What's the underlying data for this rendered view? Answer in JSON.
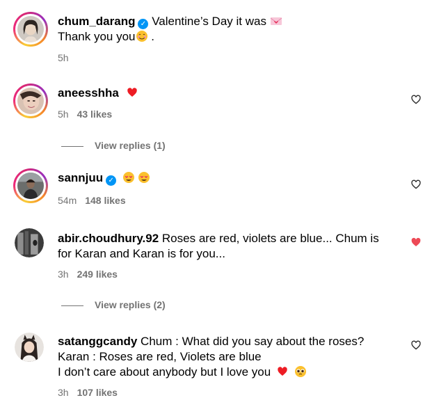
{
  "caption": {
    "username": "chum_darang",
    "line1": "Valentine’s Day it was",
    "line2": "Thank you you",
    "line2_suffix": " .",
    "time": "5h"
  },
  "comments": [
    {
      "username": "aneesshha",
      "time": "5h",
      "likes": "43 likes",
      "liked": false,
      "replies": "View replies (1)"
    },
    {
      "username": "sannjuu",
      "time": "54m",
      "likes": "148 likes",
      "liked": false
    },
    {
      "username": "abir.choudhury.92",
      "text": "Roses are red, violets are blue... Chum is for Karan and Karan is for you...",
      "time": "3h",
      "likes": "249 likes",
      "liked": true,
      "replies": "View replies (2)"
    },
    {
      "username": "satanggcandy",
      "text1": "Chum : What did you say about the roses?",
      "text2": "Karan : Roses are red, Violets are blue",
      "text3": "I don’t care about anybody but I love you",
      "time": "3h",
      "likes": "107 likes",
      "liked": false
    }
  ],
  "colors": {
    "liked_heart": "#ed4956",
    "verified": "#0095f6",
    "muted_text": "#737373"
  },
  "icons": [
    "verified-badge-icon",
    "heart-icon",
    "smiling-face-emoji",
    "heart-eyes-emoji",
    "pleading-face-emoji",
    "love-letter-emoji"
  ]
}
